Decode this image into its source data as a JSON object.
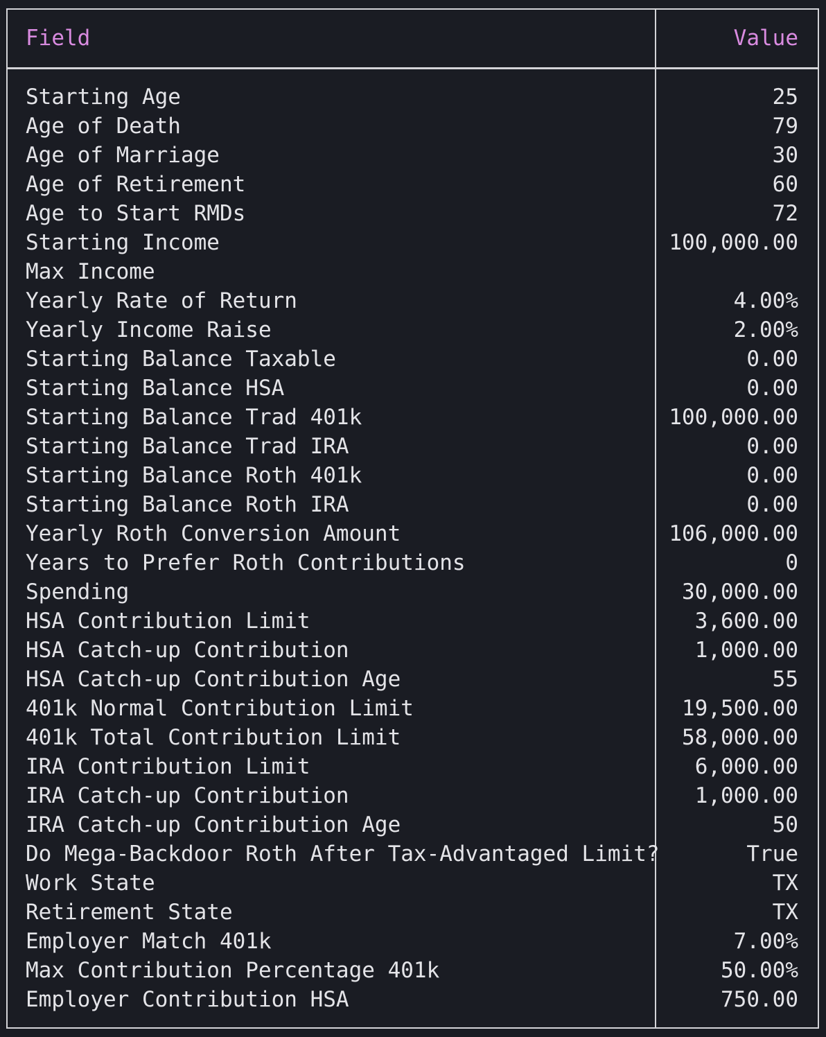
{
  "table": {
    "header": {
      "field": "Field",
      "value": "Value"
    },
    "rows": [
      {
        "field": "Starting Age",
        "value": "25"
      },
      {
        "field": "Age of Death",
        "value": "79"
      },
      {
        "field": "Age of Marriage",
        "value": "30"
      },
      {
        "field": "Age of Retirement",
        "value": "60"
      },
      {
        "field": "Age to Start RMDs",
        "value": "72"
      },
      {
        "field": "Starting Income",
        "value": "100,000.00"
      },
      {
        "field": "Max Income",
        "value": ""
      },
      {
        "field": "Yearly Rate of Return",
        "value": "4.00%"
      },
      {
        "field": "Yearly Income Raise",
        "value": "2.00%"
      },
      {
        "field": "Starting Balance Taxable",
        "value": "0.00"
      },
      {
        "field": "Starting Balance HSA",
        "value": "0.00"
      },
      {
        "field": "Starting Balance Trad 401k",
        "value": "100,000.00"
      },
      {
        "field": "Starting Balance Trad IRA",
        "value": "0.00"
      },
      {
        "field": "Starting Balance Roth 401k",
        "value": "0.00"
      },
      {
        "field": "Starting Balance Roth IRA",
        "value": "0.00"
      },
      {
        "field": "Yearly Roth Conversion Amount",
        "value": "106,000.00"
      },
      {
        "field": "Years to Prefer Roth Contributions",
        "value": "0"
      },
      {
        "field": "Spending",
        "value": "30,000.00"
      },
      {
        "field": "HSA Contribution Limit",
        "value": "3,600.00"
      },
      {
        "field": "HSA Catch-up Contribution",
        "value": "1,000.00"
      },
      {
        "field": "HSA Catch-up Contribution Age",
        "value": "55"
      },
      {
        "field": "401k Normal Contribution Limit",
        "value": "19,500.00"
      },
      {
        "field": "401k Total Contribution Limit",
        "value": "58,000.00"
      },
      {
        "field": "IRA Contribution Limit",
        "value": "6,000.00"
      },
      {
        "field": "IRA Catch-up Contribution",
        "value": "1,000.00"
      },
      {
        "field": "IRA Catch-up Contribution Age",
        "value": "50"
      },
      {
        "field": "Do Mega-Backdoor Roth After Tax-Advantaged Limit?",
        "value": "True"
      },
      {
        "field": "Work State",
        "value": "TX"
      },
      {
        "field": "Retirement State",
        "value": "TX"
      },
      {
        "field": "Employer Match 401k",
        "value": "7.00%"
      },
      {
        "field": "Max Contribution Percentage 401k",
        "value": "50.00%"
      },
      {
        "field": "Employer Contribution HSA",
        "value": "750.00"
      }
    ]
  },
  "colors": {
    "background": "#1a1c23",
    "border": "#d4d4d8",
    "header_text": "#d98be0",
    "body_text": "#e4e4e8"
  }
}
